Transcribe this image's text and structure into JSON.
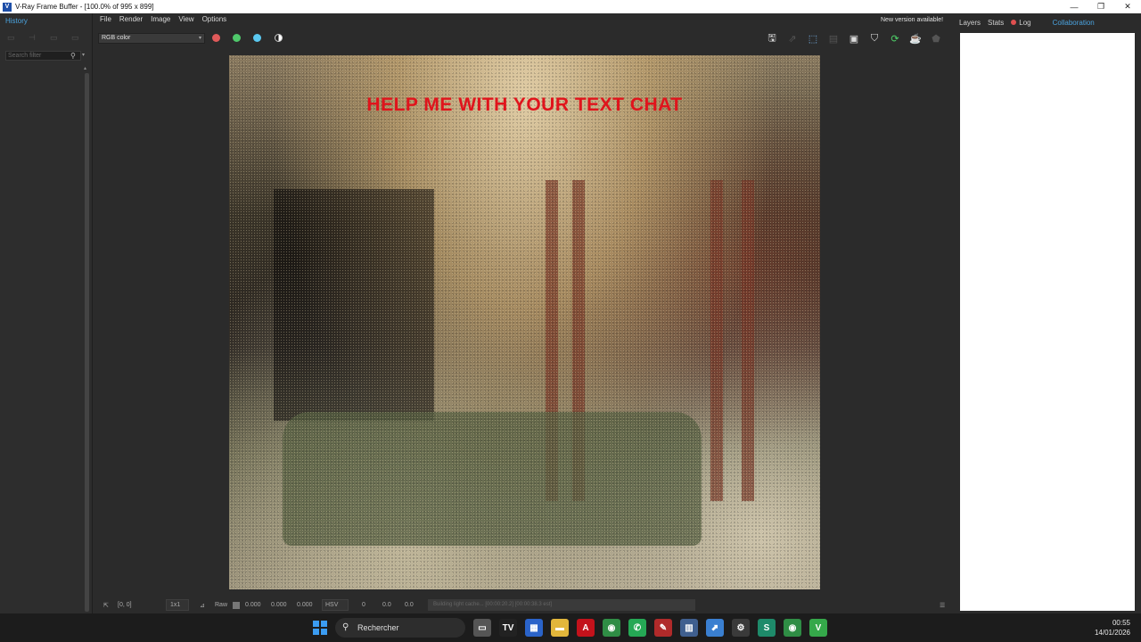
{
  "window": {
    "title": "V-Ray Frame Buffer - [100.0% of 995 x 899]",
    "app_icon": "V",
    "controls": [
      "—",
      "❐",
      "✕"
    ]
  },
  "history_panel": {
    "tab": "History",
    "filter_placeholder": "Search filter"
  },
  "menu": {
    "items": [
      "File",
      "Render",
      "Image",
      "View",
      "Options"
    ]
  },
  "notification": "New version available!",
  "toolbar": {
    "channel": "RGB color",
    "colors": {
      "red": "#e05a5a",
      "green": "#4fc86b",
      "blue": "#5ac8f0"
    }
  },
  "render": {
    "overlay_text": "HELP ME WITH YOUR TEXT CHAT"
  },
  "statusbar": {
    "coords": "[0, 0]",
    "zoom": "1x1",
    "mode": "Raw",
    "val_r": "0.000",
    "val_g": "0.000",
    "val_b": "0.000",
    "colorspace": "HSV",
    "h": "0",
    "s": "0.0",
    "v": "0.0",
    "progress_text": "Building light cache... [00:00:20.2] [00:00:38.3 est]"
  },
  "side_panel": {
    "tabs": [
      "Layers",
      "Stats",
      "Log"
    ],
    "collab": "Collaboration"
  },
  "taskbar": {
    "search_label": "Rechercher",
    "time": "00:55",
    "date": "14/01/2026"
  }
}
